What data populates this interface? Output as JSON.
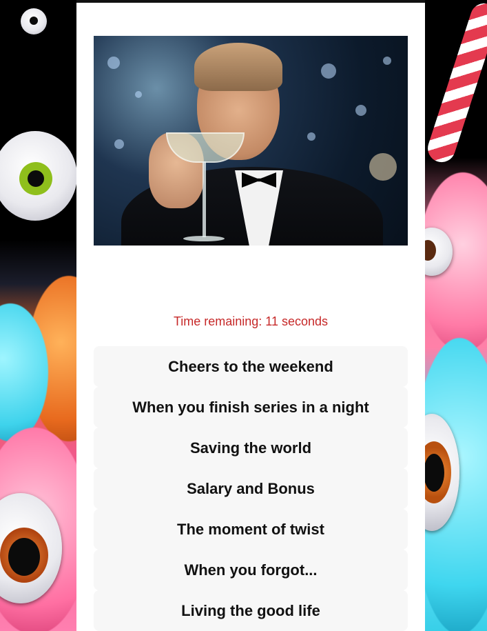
{
  "meme": {
    "alt_icon": "toast-champagne-meme"
  },
  "timer": {
    "text": "Time remaining: 11 seconds",
    "seconds": 11,
    "color": "#c62828"
  },
  "options": [
    {
      "label": "Cheers to the weekend"
    },
    {
      "label": "When you finish series in a night"
    },
    {
      "label": "Saving the world"
    },
    {
      "label": "Salary and Bonus"
    },
    {
      "label": "The moment of twist"
    },
    {
      "label": "When you forgot..."
    },
    {
      "label": "Living the good life"
    }
  ]
}
